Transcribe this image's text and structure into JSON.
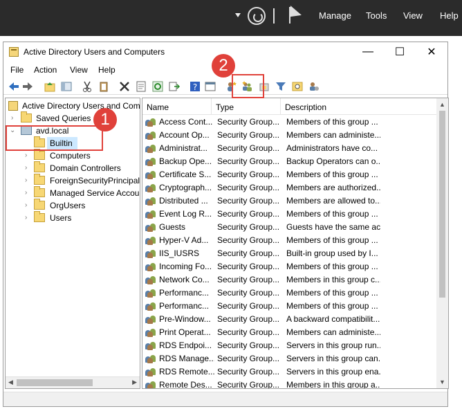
{
  "host": {
    "menu": [
      "Manage",
      "Tools",
      "View",
      "Help"
    ]
  },
  "window": {
    "title": "Active Directory Users and Computers",
    "buttons": {
      "minimize": "—",
      "maximize": "☐",
      "close": "✕"
    }
  },
  "menubar": [
    "File",
    "Action",
    "View",
    "Help"
  ],
  "tree": {
    "root": "Active Directory Users and Com",
    "saved_queries": "Saved Queries",
    "domain": "avd.local",
    "children": [
      "Builtin",
      "Computers",
      "Domain Controllers",
      "ForeignSecurityPrincipals",
      "Managed Service Accoun",
      "OrgUsers",
      "Users"
    ]
  },
  "list": {
    "columns": [
      "Name",
      "Type",
      "Description"
    ],
    "rows": [
      {
        "name": "Access Cont...",
        "type": "Security Group...",
        "desc": "Members of this group ..."
      },
      {
        "name": "Account Op...",
        "type": "Security Group...",
        "desc": "Members can administe..."
      },
      {
        "name": "Administrat...",
        "type": "Security Group...",
        "desc": "Administrators have co..."
      },
      {
        "name": "Backup Ope...",
        "type": "Security Group...",
        "desc": "Backup Operators can o..."
      },
      {
        "name": "Certificate S...",
        "type": "Security Group...",
        "desc": "Members of this group ..."
      },
      {
        "name": "Cryptograph...",
        "type": "Security Group...",
        "desc": "Members are authorized..."
      },
      {
        "name": "Distributed ...",
        "type": "Security Group...",
        "desc": "Members are allowed to..."
      },
      {
        "name": "Event Log R...",
        "type": "Security Group...",
        "desc": "Members of this group ..."
      },
      {
        "name": "Guests",
        "type": "Security Group...",
        "desc": "Guests have the same ac..."
      },
      {
        "name": "Hyper-V Ad...",
        "type": "Security Group...",
        "desc": "Members of this group ..."
      },
      {
        "name": "IIS_IUSRS",
        "type": "Security Group...",
        "desc": "Built-in group used by I..."
      },
      {
        "name": "Incoming Fo...",
        "type": "Security Group...",
        "desc": "Members of this group ..."
      },
      {
        "name": "Network Co...",
        "type": "Security Group...",
        "desc": "Members in this group c..."
      },
      {
        "name": "Performanc...",
        "type": "Security Group...",
        "desc": "Members of this group ..."
      },
      {
        "name": "Performanc...",
        "type": "Security Group...",
        "desc": "Members of this group ..."
      },
      {
        "name": "Pre-Window...",
        "type": "Security Group...",
        "desc": "A backward compatibilit..."
      },
      {
        "name": "Print Operat...",
        "type": "Security Group...",
        "desc": "Members can administe..."
      },
      {
        "name": "RDS Endpoi...",
        "type": "Security Group...",
        "desc": "Servers in this group run..."
      },
      {
        "name": "RDS Manage...",
        "type": "Security Group...",
        "desc": "Servers in this group can..."
      },
      {
        "name": "RDS Remote...",
        "type": "Security Group...",
        "desc": "Servers in this group ena..."
      },
      {
        "name": "Remote Des...",
        "type": "Security Group...",
        "desc": "Members in this group a..."
      }
    ]
  },
  "annotations": {
    "badge1": "1",
    "badge2": "2"
  },
  "colors": {
    "annotation": "#e0413a",
    "selection": "#cce8ff",
    "host_bar": "#2b2b2b"
  }
}
